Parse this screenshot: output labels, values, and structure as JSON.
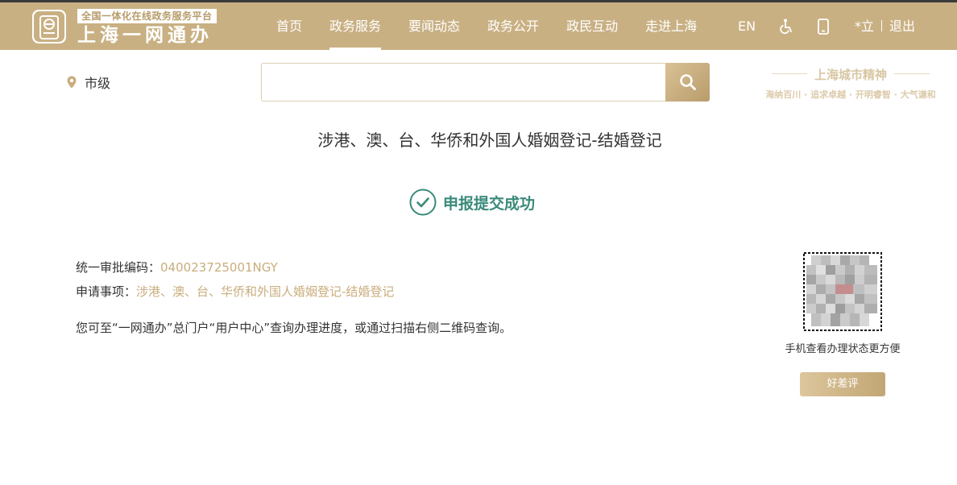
{
  "header": {
    "logo_tag": "全国一体化在线政务服务平台",
    "logo_title": "上海一网通办",
    "nav": [
      {
        "label": "首页",
        "active": false
      },
      {
        "label": "政务服务",
        "active": true
      },
      {
        "label": "要闻动态",
        "active": false
      },
      {
        "label": "政务公开",
        "active": false
      },
      {
        "label": "政民互动",
        "active": false
      },
      {
        "label": "走进上海",
        "active": false
      }
    ],
    "lang": "EN",
    "accessibility_icon": "wheelchair-icon",
    "mobile_icon": "mobile-phone-icon",
    "user": "*立",
    "logout": "退出"
  },
  "location": {
    "icon": "map-pin-icon",
    "label": "市级"
  },
  "search": {
    "value": "",
    "placeholder": "",
    "icon": "search-icon"
  },
  "city_spirit": {
    "title": "上海城市精神",
    "subtitle": "海纳百川 · 追求卓越 · 开明睿智 · 大气谦和"
  },
  "main": {
    "matter_title": "涉港、澳、台、华侨和外国人婚姻登记-结婚登记",
    "success_icon": "check-circle-icon",
    "success_text": "申报提交成功",
    "code_label": "统一审批编码：",
    "code_value": "040023725001NGY",
    "item_label": "申请事项：",
    "item_value": "涉港、澳、台、华侨和外国人婚姻登记-结婚登记",
    "tip": "您可至“一网通办”总门户“用户中心”查询办理进度，或通过扫描右侧二维码查询。"
  },
  "qr": {
    "caption": "手机查看办理状态更方便",
    "rate_button": "好差评"
  },
  "colors": {
    "brand_gold": "#c9b083",
    "success_green": "#3a8a7a",
    "value_gold": "#c9ad7d"
  }
}
